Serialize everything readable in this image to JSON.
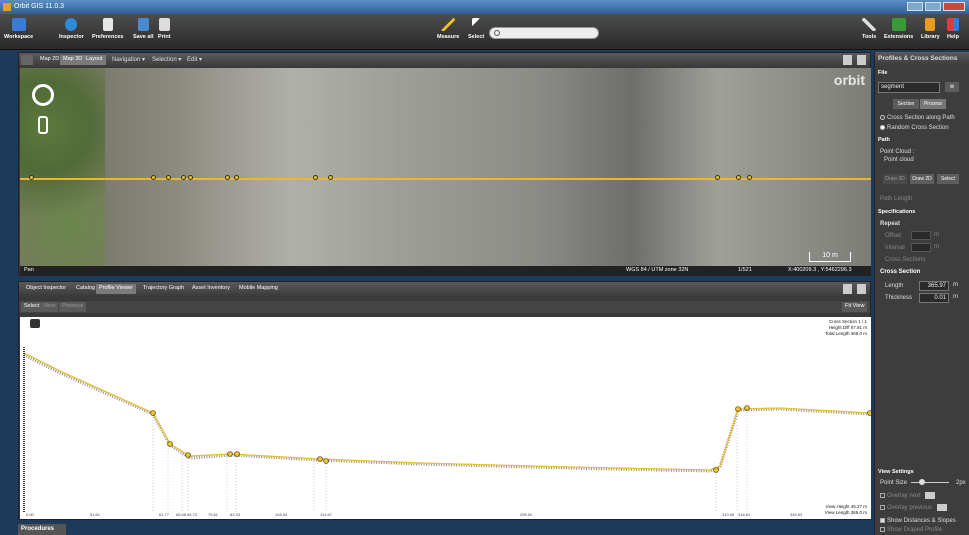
{
  "window": {
    "title": "Orbit GIS 11.0.3"
  },
  "toolbar": {
    "workspace": "Workspace",
    "inspector": "Inspector",
    "preferences": "Preferences",
    "save_all": "Save all",
    "print": "Print",
    "measure": "Measure",
    "select": "Select",
    "tools": "Tools",
    "extensions": "Extensions",
    "library": "Library",
    "help": "Help",
    "search_placeholder": ""
  },
  "map": {
    "tabs": [
      "Map 2D",
      "Map 3D",
      "Layout"
    ],
    "menus": [
      "Navigation",
      "Selection",
      "Edit"
    ],
    "logo": "orbit",
    "scale": "10 m",
    "status": {
      "mode": "Pan",
      "crs": "WGS 84 / UTM zone 32N",
      "page": "1/521",
      "coords": "X:400209.3 , Y:5462296.3"
    }
  },
  "profile_panel": {
    "tabs": [
      "Object Inspector",
      "Catalog",
      "Profile Viewer",
      "Trajectory Graph",
      "Asset Inventory",
      "Mobile Mapping"
    ],
    "tools": {
      "select": "Select",
      "next": "Next",
      "previous": "Previous",
      "fit_view": "Fit View"
    },
    "info": {
      "cross_section": "Cross Section 1 / 1",
      "height_diff": "Height Diff 67.91 m",
      "total_length": "Total Length 365.0 m"
    },
    "view": {
      "view_height": "View Height 46.27 m",
      "view_length": "View Length 365.0 m"
    },
    "ticks": [
      "0.00",
      "51.61",
      "61.77",
      "66.68",
      "68.73",
      "75.61",
      "83.33",
      "108.54",
      "114.67",
      "188.31",
      "295.52",
      "310.96",
      "316.81",
      "345.53"
    ]
  },
  "procedures": {
    "label": "Procedures"
  },
  "right_panel": {
    "title": "Profiles & Cross Sections",
    "file": {
      "label": "File",
      "value": "segment"
    },
    "buttons": {
      "section": "Section",
      "process": "Process"
    },
    "modes": {
      "along_path": "Cross Section along Path",
      "random": "Random Cross Section"
    },
    "path": {
      "label": "Path",
      "point_cloud_label": "Point Cloud :",
      "point_cloud_value": "Point cloud",
      "draw_3d": "Draw 3D",
      "draw_2d": "Draw 2D",
      "select": "Select",
      "path_length": "Path Length"
    },
    "specifications": {
      "label": "Specifications",
      "repeat": "Repeat",
      "offset": "Offset",
      "interval": "Interval",
      "cross_sections": "Cross Sections",
      "unit": "m"
    },
    "cross_section": {
      "label": "Cross Section",
      "length_label": "Length",
      "length_value": "365.97",
      "thickness_label": "Thickness",
      "thickness_value": "0.01",
      "unit": "m"
    },
    "view_settings": {
      "label": "View Settings",
      "point_size_label": "Point Size",
      "point_size_value": "2px",
      "overlay_next": "Overlay next",
      "overlay_previous": "Overlay previous",
      "show_distances": "Show Distances & Slopes",
      "show_draped": "Show Draped Profile"
    }
  }
}
